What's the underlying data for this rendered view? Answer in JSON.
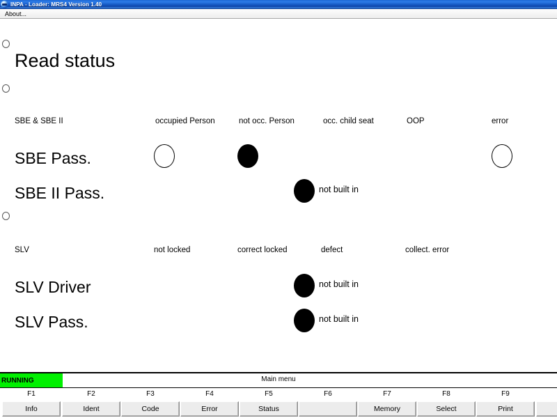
{
  "window": {
    "title": "INPA - Loader: MRS4 Version 1.40",
    "icon": "inpa-globe-icon"
  },
  "menubar": {
    "items": [
      {
        "label": "About..."
      }
    ]
  },
  "page": {
    "title": "Read status"
  },
  "sections": [
    {
      "id": "sbe",
      "header": {
        "lead": "SBE & SBE II",
        "columns": [
          "occupied Person",
          "not occ. Person",
          "occ. child seat",
          "OOP",
          "error"
        ]
      },
      "rows": [
        {
          "label": "SBE Pass.",
          "indicators": [
            {
              "column": "occupied Person",
              "state": "empty"
            },
            {
              "column": "not occ. Person",
              "state": "filled"
            },
            {
              "column": "error",
              "state": "empty"
            }
          ],
          "note": ""
        },
        {
          "label": "SBE II Pass.",
          "indicators": [
            {
              "column": "occ. child seat",
              "state": "filled"
            }
          ],
          "note": "not built in"
        }
      ]
    },
    {
      "id": "slv",
      "header": {
        "lead": "SLV",
        "columns": [
          "not locked",
          "correct locked",
          "defect",
          "collect. error"
        ]
      },
      "rows": [
        {
          "label": "SLV Driver",
          "indicators": [
            {
              "column": "defect",
              "state": "filled"
            }
          ],
          "note": "not built in"
        },
        {
          "label": "SLV Pass.",
          "indicators": [
            {
              "column": "defect",
              "state": "filled"
            }
          ],
          "note": "not built in"
        }
      ]
    }
  ],
  "statusbar": {
    "status_text": "RUNNING",
    "status_color": "#00f000",
    "menu_title": "Main menu"
  },
  "fkeys": [
    {
      "key": "F1",
      "label": "Info"
    },
    {
      "key": "F2",
      "label": "Ident"
    },
    {
      "key": "F3",
      "label": "Code"
    },
    {
      "key": "F4",
      "label": "Error"
    },
    {
      "key": "F5",
      "label": "Status"
    },
    {
      "key": "F6",
      "label": ""
    },
    {
      "key": "F7",
      "label": "Memory"
    },
    {
      "key": "F8",
      "label": "Select"
    },
    {
      "key": "F9",
      "label": "Print"
    },
    {
      "key": "",
      "label": ""
    }
  ]
}
